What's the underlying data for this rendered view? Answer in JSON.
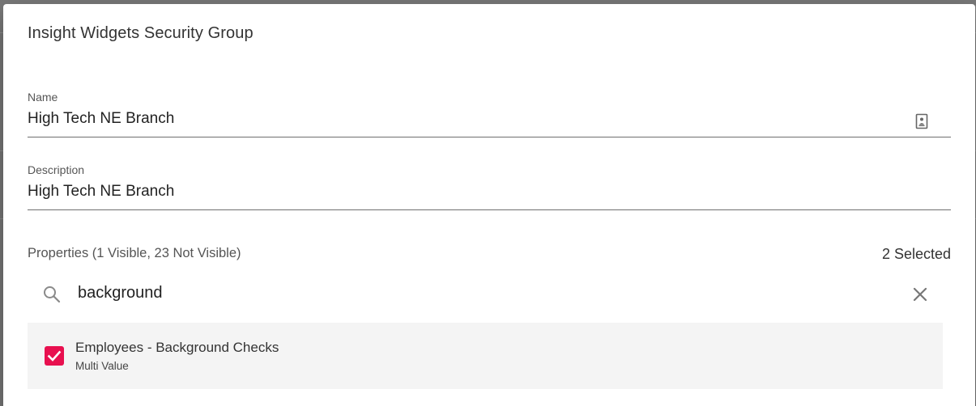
{
  "dialog": {
    "title": "Insight Widgets Security Group"
  },
  "name_field": {
    "label": "Name",
    "value": "High Tech NE Branch",
    "icon": "contact-card-icon"
  },
  "description_field": {
    "label": "Description",
    "value": "High Tech NE Branch"
  },
  "properties": {
    "title": "Properties (1 Visible, 23 Not Visible)",
    "selected_count": "2 Selected",
    "search": {
      "value": "background",
      "icon": "search-icon",
      "clear_icon": "close-icon"
    },
    "items": [
      {
        "title": "Employees - Background Checks",
        "subtitle": "Multi Value",
        "checked": true
      }
    ]
  },
  "colors": {
    "accent": "#e8104f",
    "item_background": "#f4f4f4",
    "backdrop": "#7a7a7a"
  }
}
